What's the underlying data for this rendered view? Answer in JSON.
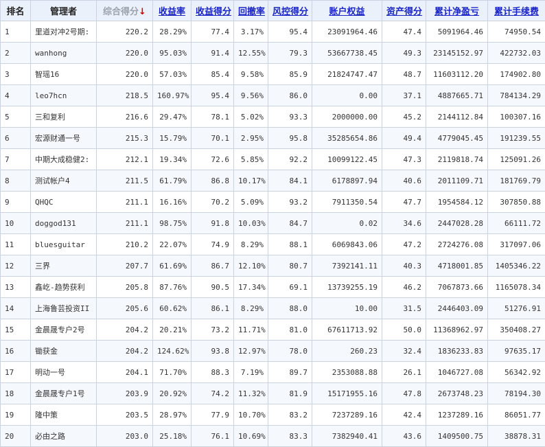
{
  "headers": {
    "rank": "排名",
    "manager": "管理者",
    "composite_score": "综合得分",
    "sort_indicator": "↓",
    "return_rate": "收益率",
    "return_score": "收益得分",
    "drawdown": "回撤率",
    "risk_score": "风控得分",
    "equity": "账户权益",
    "asset_score": "资产得分",
    "cum_net_pnl": "累计净盈亏",
    "cum_fees": "累计手续费"
  },
  "colors": {
    "link": "#1a25c8",
    "pnl_red": "#e00000",
    "sort_arrow": "#d00000"
  },
  "rows": [
    {
      "rank": "1",
      "manager": "里道对冲2号期:",
      "composite": "220.2",
      "return_rate": "28.29%",
      "return_score": "77.4",
      "drawdown": "3.17%",
      "risk_score": "95.4",
      "equity": "23091964.46",
      "asset_score": "47.4",
      "net_pnl": "5091964.46",
      "fees": "74950.54"
    },
    {
      "rank": "2",
      "manager": "wanhong",
      "composite": "220.0",
      "return_rate": "95.03%",
      "return_score": "91.4",
      "drawdown": "12.55%",
      "risk_score": "79.3",
      "equity": "53667738.45",
      "asset_score": "49.3",
      "net_pnl": "23145152.97",
      "fees": "422732.03"
    },
    {
      "rank": "3",
      "manager": "智瑶16",
      "composite": "220.0",
      "return_rate": "57.03%",
      "return_score": "85.4",
      "drawdown": "9.58%",
      "risk_score": "85.9",
      "equity": "21824747.47",
      "asset_score": "48.7",
      "net_pnl": "11603112.20",
      "fees": "174902.80"
    },
    {
      "rank": "4",
      "manager": "leo7hcn",
      "composite": "218.5",
      "return_rate": "160.97%",
      "return_score": "95.4",
      "drawdown": "9.56%",
      "risk_score": "86.0",
      "equity": "0.00",
      "asset_score": "37.1",
      "net_pnl": "4887665.71",
      "fees": "784134.29"
    },
    {
      "rank": "5",
      "manager": "三和复利",
      "composite": "216.6",
      "return_rate": "29.47%",
      "return_score": "78.1",
      "drawdown": "5.02%",
      "risk_score": "93.3",
      "equity": "2000000.00",
      "asset_score": "45.2",
      "net_pnl": "2144112.84",
      "fees": "100307.16"
    },
    {
      "rank": "6",
      "manager": "宏源财通一号",
      "composite": "215.3",
      "return_rate": "15.79%",
      "return_score": "70.1",
      "drawdown": "2.95%",
      "risk_score": "95.8",
      "equity": "35285654.86",
      "asset_score": "49.4",
      "net_pnl": "4779045.45",
      "fees": "191239.55"
    },
    {
      "rank": "7",
      "manager": "中期大成稳健2:",
      "composite": "212.1",
      "return_rate": "19.34%",
      "return_score": "72.6",
      "drawdown": "5.85%",
      "risk_score": "92.2",
      "equity": "10099122.45",
      "asset_score": "47.3",
      "net_pnl": "2119818.74",
      "fees": "125091.26"
    },
    {
      "rank": "8",
      "manager": "测试帐户4",
      "composite": "211.5",
      "return_rate": "61.79%",
      "return_score": "86.8",
      "drawdown": "10.17%",
      "risk_score": "84.1",
      "equity": "6178897.94",
      "asset_score": "40.6",
      "net_pnl": "2011109.71",
      "fees": "181769.79"
    },
    {
      "rank": "9",
      "manager": "QHQC",
      "composite": "211.1",
      "return_rate": "16.16%",
      "return_score": "70.2",
      "drawdown": "5.09%",
      "risk_score": "93.2",
      "equity": "7911350.54",
      "asset_score": "47.7",
      "net_pnl": "1954584.12",
      "fees": "307850.88"
    },
    {
      "rank": "10",
      "manager": "doggod131",
      "composite": "211.1",
      "return_rate": "98.75%",
      "return_score": "91.8",
      "drawdown": "10.03%",
      "risk_score": "84.7",
      "equity": "0.02",
      "asset_score": "34.6",
      "net_pnl": "2447028.28",
      "fees": "66111.72"
    },
    {
      "rank": "11",
      "manager": "bluesguitar",
      "composite": "210.2",
      "return_rate": "22.07%",
      "return_score": "74.9",
      "drawdown": "8.29%",
      "risk_score": "88.1",
      "equity": "6069843.06",
      "asset_score": "47.2",
      "net_pnl": "2724276.08",
      "fees": "317097.06"
    },
    {
      "rank": "12",
      "manager": "三界",
      "composite": "207.7",
      "return_rate": "61.69%",
      "return_score": "86.7",
      "drawdown": "12.10%",
      "risk_score": "80.7",
      "equity": "7392141.11",
      "asset_score": "40.3",
      "net_pnl": "4718001.85",
      "fees": "1405346.22"
    },
    {
      "rank": "13",
      "manager": "鑫屹-趋势获利",
      "composite": "205.8",
      "return_rate": "87.76%",
      "return_score": "90.5",
      "drawdown": "17.34%",
      "risk_score": "69.1",
      "equity": "13739255.19",
      "asset_score": "46.2",
      "net_pnl": "7067873.66",
      "fees": "1165078.34"
    },
    {
      "rank": "14",
      "manager": "上海鲁芸投资II",
      "composite": "205.6",
      "return_rate": "60.62%",
      "return_score": "86.1",
      "drawdown": "8.29%",
      "risk_score": "88.0",
      "equity": "10.00",
      "asset_score": "31.5",
      "net_pnl": "2446403.09",
      "fees": "51276.91"
    },
    {
      "rank": "15",
      "manager": "金晨晟专户2号",
      "composite": "204.2",
      "return_rate": "20.21%",
      "return_score": "73.2",
      "drawdown": "11.71%",
      "risk_score": "81.0",
      "equity": "67611713.92",
      "asset_score": "50.0",
      "net_pnl": "11368962.97",
      "fees": "350408.27"
    },
    {
      "rank": "16",
      "manager": "锄获金",
      "composite": "204.2",
      "return_rate": "124.62%",
      "return_score": "93.8",
      "drawdown": "12.97%",
      "risk_score": "78.0",
      "equity": "260.23",
      "asset_score": "32.4",
      "net_pnl": "1836233.83",
      "fees": "97635.17"
    },
    {
      "rank": "17",
      "manager": "明动一号",
      "composite": "204.1",
      "return_rate": "71.70%",
      "return_score": "88.3",
      "drawdown": "7.19%",
      "risk_score": "89.7",
      "equity": "2353088.88",
      "asset_score": "26.1",
      "net_pnl": "1046727.08",
      "fees": "56342.92"
    },
    {
      "rank": "18",
      "manager": "金晨晟专户1号",
      "composite": "203.9",
      "return_rate": "20.92%",
      "return_score": "74.2",
      "drawdown": "11.32%",
      "risk_score": "81.9",
      "equity": "15171955.16",
      "asset_score": "47.8",
      "net_pnl": "2673748.23",
      "fees": "78194.30"
    },
    {
      "rank": "19",
      "manager": "隆中策",
      "composite": "203.5",
      "return_rate": "28.97%",
      "return_score": "77.9",
      "drawdown": "10.70%",
      "risk_score": "83.2",
      "equity": "7237289.16",
      "asset_score": "42.4",
      "net_pnl": "1237289.16",
      "fees": "86051.77"
    },
    {
      "rank": "20",
      "manager": "必由之路",
      "composite": "203.0",
      "return_rate": "25.18%",
      "return_score": "76.1",
      "drawdown": "10.69%",
      "risk_score": "83.3",
      "equity": "7382940.41",
      "asset_score": "43.6",
      "net_pnl": "1409500.75",
      "fees": "38878.31"
    }
  ]
}
